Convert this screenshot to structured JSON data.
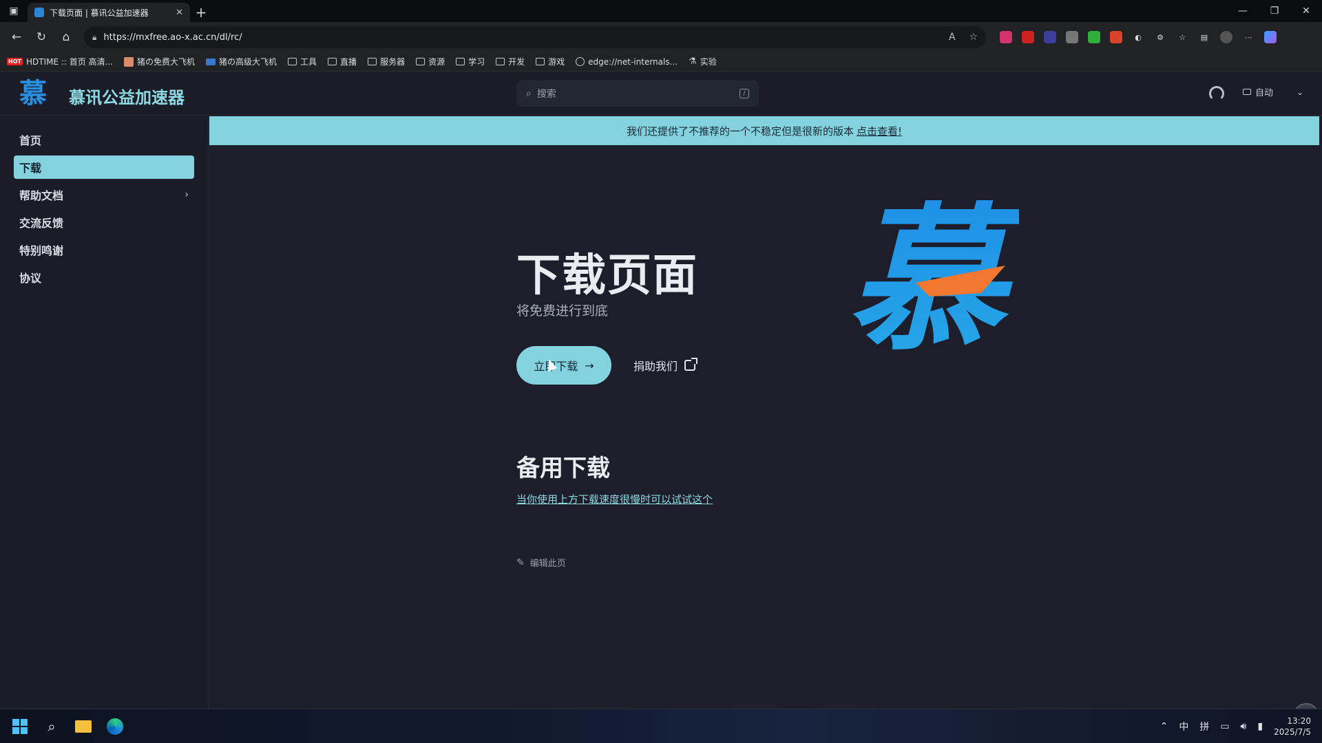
{
  "browser": {
    "tab_title": "下载页面 | 慕讯公益加速器",
    "url": "https://mxfree.ao-x.ac.cn/dl/rc/",
    "bookmarks": [
      {
        "label": "HDTIME :: 首页 高清...",
        "icon": "hot"
      },
      {
        "label": "猪の免费大飞机",
        "icon": "img"
      },
      {
        "label": "猪の高级大飞机",
        "icon": "img2"
      },
      {
        "label": "工具",
        "icon": "folder"
      },
      {
        "label": "直播",
        "icon": "folder"
      },
      {
        "label": "服务器",
        "icon": "folder"
      },
      {
        "label": "资源",
        "icon": "folder"
      },
      {
        "label": "学习",
        "icon": "folder"
      },
      {
        "label": "开发",
        "icon": "folder"
      },
      {
        "label": "游戏",
        "icon": "folder"
      },
      {
        "label": "edge://net-internals...",
        "icon": "globe"
      },
      {
        "label": "实验",
        "icon": "flask"
      }
    ]
  },
  "site": {
    "logo_char": "慕",
    "title": "慕讯公益加速器",
    "search_placeholder": "搜索",
    "theme_label": "自动"
  },
  "sidebar": {
    "items": [
      {
        "label": "首页"
      },
      {
        "label": "下载"
      },
      {
        "label": "帮助文档"
      },
      {
        "label": "交流反馈"
      },
      {
        "label": "特别鸣谢"
      },
      {
        "label": "协议"
      }
    ]
  },
  "banner": {
    "text": "我们还提供了不推荐的一个不稳定但是很新的版本",
    "link": "点击查看!"
  },
  "hero": {
    "title": "下载页面",
    "subtitle": "将免费进行到底",
    "download_btn": "立即下载",
    "donate_btn": "捐助我们",
    "logo_char": "慕"
  },
  "alt": {
    "title": "备用下载",
    "link": "当你使用上方下载速度很慢时可以试试这个"
  },
  "edit_label": "编辑此页",
  "taskbar": {
    "tray_ime1": "中",
    "tray_ime2": "拼",
    "time": "13:20",
    "date": "2025/7/5"
  }
}
